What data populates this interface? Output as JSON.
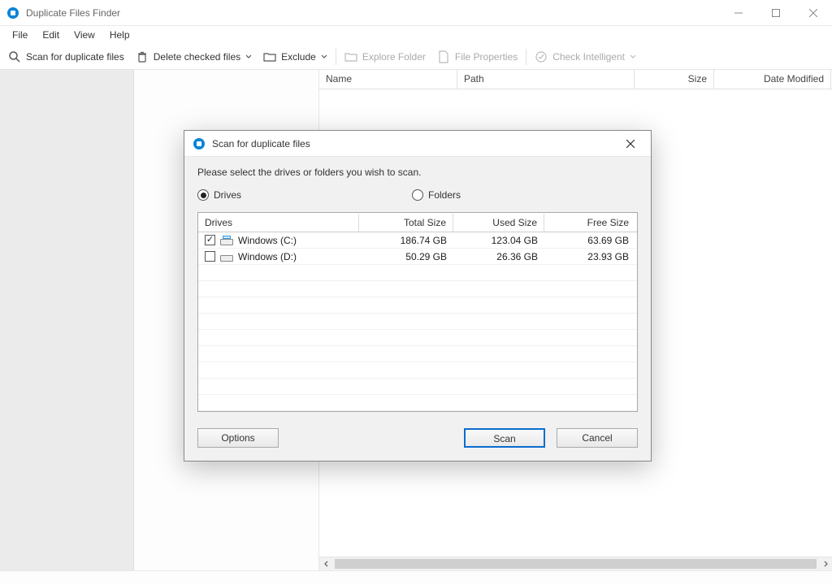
{
  "window": {
    "title": "Duplicate Files Finder"
  },
  "menu": [
    "File",
    "Edit",
    "View",
    "Help"
  ],
  "toolbar": {
    "scan": "Scan for duplicate files",
    "delete": "Delete checked files",
    "exclude": "Exclude",
    "explore": "Explore Folder",
    "properties": "File Properties",
    "intelligent": "Check Intelligent"
  },
  "columns": {
    "name": "Name",
    "path": "Path",
    "size": "Size",
    "date": "Date Modified"
  },
  "dialog": {
    "title": "Scan for duplicate files",
    "instruction": "Please select the drives or folders you wish to scan.",
    "radio_drives": "Drives",
    "radio_folders": "Folders",
    "cols": {
      "drives": "Drives",
      "total": "Total Size",
      "used": "Used Size",
      "free": "Free Size"
    },
    "rows": [
      {
        "checked": true,
        "name": "Windows (C:)",
        "total": "186.74 GB",
        "used": "123.04 GB",
        "free": "63.69 GB"
      },
      {
        "checked": false,
        "name": "Windows (D:)",
        "total": "50.29 GB",
        "used": "26.36 GB",
        "free": "23.93 GB"
      }
    ],
    "btn_options": "Options",
    "btn_scan": "Scan",
    "btn_cancel": "Cancel"
  }
}
